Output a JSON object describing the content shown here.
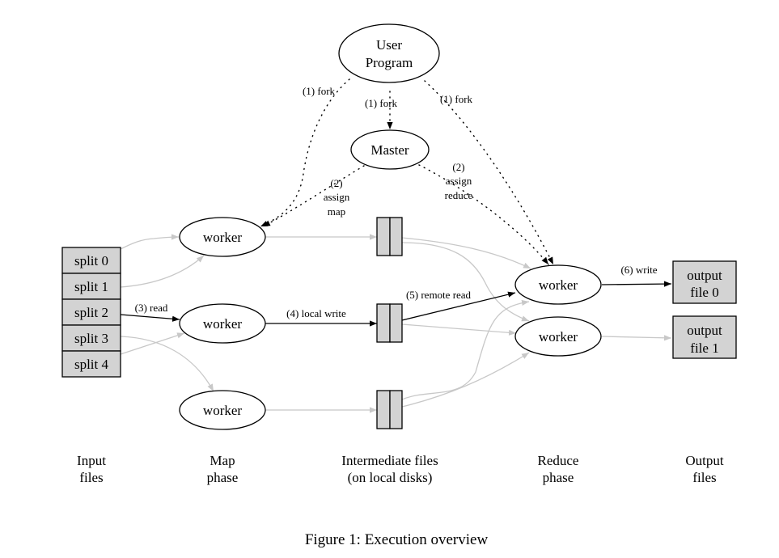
{
  "nodes": {
    "user_program": [
      "User",
      "Program"
    ],
    "master": "Master",
    "map_workers": [
      "worker",
      "worker",
      "worker"
    ],
    "reduce_workers": [
      "worker",
      "worker"
    ],
    "splits": [
      "split 0",
      "split 1",
      "split 2",
      "split 3",
      "split 4"
    ],
    "outputs": [
      [
        "output",
        "file 0"
      ],
      [
        "output",
        "file 1"
      ]
    ]
  },
  "edge_labels": {
    "fork_left": "(1) fork",
    "fork_center": "(1) fork",
    "fork_right": "(1) fork",
    "assign_map": [
      "(2)",
      "assign",
      "map"
    ],
    "assign_reduce": [
      "(2)",
      "assign",
      "reduce"
    ],
    "read": "(3) read",
    "local_write": "(4) local write",
    "remote_read": "(5) remote read",
    "write": "(6) write"
  },
  "phases": [
    [
      "Input",
      "files"
    ],
    [
      "Map",
      "phase"
    ],
    [
      "Intermediate files",
      "(on local disks)"
    ],
    [
      "Reduce",
      "phase"
    ],
    [
      "Output",
      "files"
    ]
  ],
  "caption": "Figure 1: Execution overview",
  "colors": {
    "box_fill": "#d3d3d3",
    "inactive_edge": "#c8c8c8",
    "active_edge": "#000000"
  }
}
